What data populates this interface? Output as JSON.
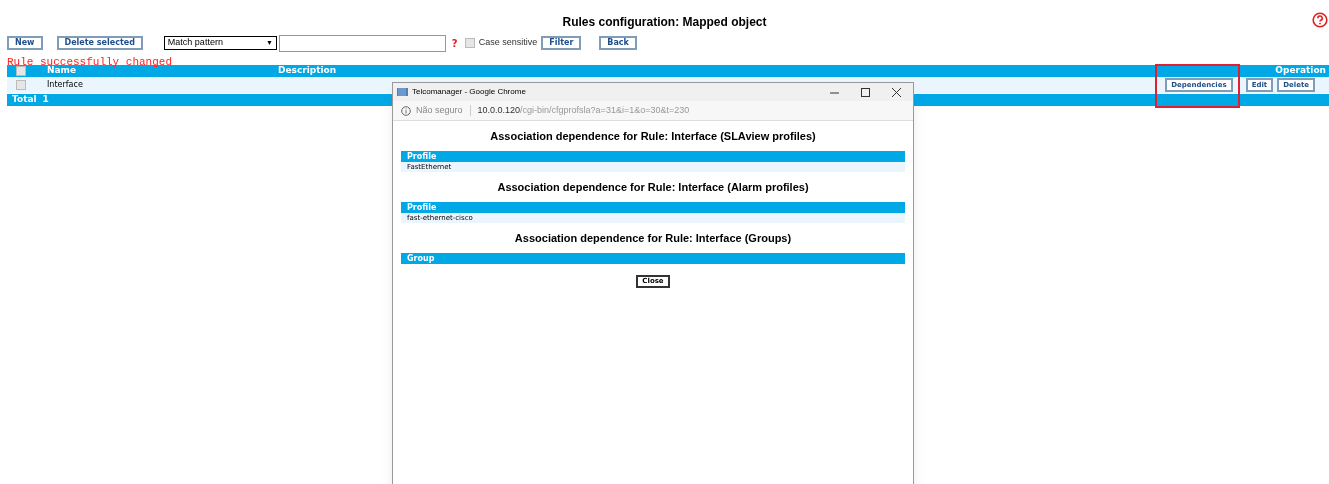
{
  "page_title": "Rules configuration: Mapped object",
  "toolbar": {
    "buttons": [
      "New",
      "Delete selected"
    ],
    "match_select": "Match pattern",
    "select_arrow": "▼",
    "help_mark": "?",
    "case_sensitive": {
      "label": "Case sensitive",
      "checked": false
    },
    "filter_button": "Filter",
    "back_button": "Back"
  },
  "message": "Rule successfully changed",
  "table": {
    "header_checked": false,
    "columns": [
      "Name",
      "Description",
      "Operation"
    ],
    "rows": [
      {
        "checked": false,
        "name": "Interface",
        "actions": [
          {
            "label": "Dependencies",
            "highlighted": true
          },
          {
            "label": "Edit",
            "highlighted": false
          },
          {
            "label": "Delete",
            "highlighted": false
          }
        ]
      }
    ],
    "total_label": "Total",
    "total": "1"
  },
  "popup": {
    "title": "Telcomanager - Google Chrome",
    "security": "Não seguro",
    "url_host": "10.0.0.120",
    "url_path": "/cgi-bin/cfgprofsla?a=31&i=1&o=30&t=230",
    "sections": [
      {
        "title": "Association dependence for Rule: Interface (SLAview profiles)",
        "column": "Profile",
        "rows": [
          "FastEthernet"
        ]
      },
      {
        "title": "Association dependence for Rule: Interface (Alarm profiles)",
        "column": "Profile",
        "rows": [
          "fast-ethernet-cisco"
        ]
      },
      {
        "title": "Association dependence for Rule: Interface (Groups)",
        "column": "Group"
      }
    ],
    "close_button": "Close"
  }
}
